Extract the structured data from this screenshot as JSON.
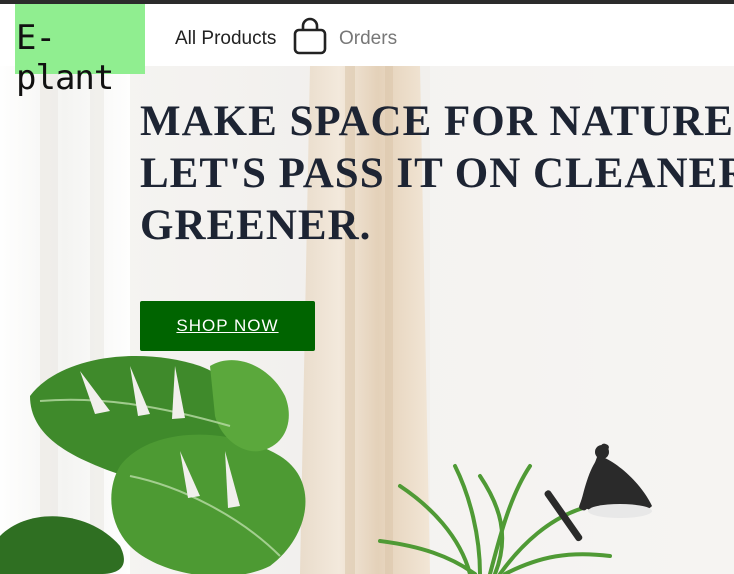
{
  "brand": {
    "logo_text": "E-plant",
    "accent": "#006400",
    "logo_bg": "#90ee90"
  },
  "nav": {
    "all_products": "All Products",
    "cart_icon": "shopping-bag-icon",
    "orders": "Orders"
  },
  "hero": {
    "headline_lines": [
      "MAKE SPACE FOR NATURE",
      "LET'S PASS IT ON CLEANER",
      "GREENER."
    ],
    "cta_label": "SHOP NOW"
  }
}
